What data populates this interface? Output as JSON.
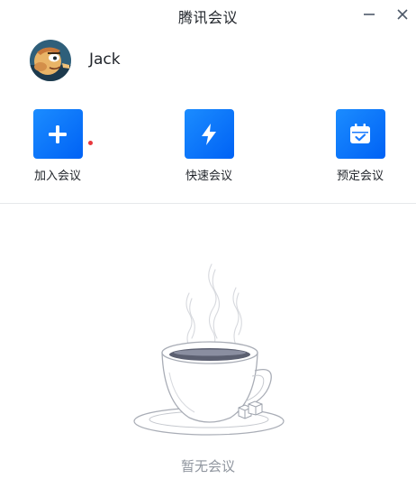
{
  "window": {
    "title": "腾讯会议"
  },
  "user": {
    "name": "Jack"
  },
  "actions": [
    {
      "label": "加入会议",
      "icon": "plus-icon"
    },
    {
      "label": "快速会议",
      "icon": "lightning-icon"
    },
    {
      "label": "预定会议",
      "icon": "calendar-check-icon"
    }
  ],
  "join_notification": true,
  "empty_state": {
    "text": "暂无会议",
    "illustration": "coffee-cup-icon"
  },
  "colors": {
    "accent": "#0a6cff",
    "dot": "#e8383d",
    "muted_text": "#8f959e"
  }
}
